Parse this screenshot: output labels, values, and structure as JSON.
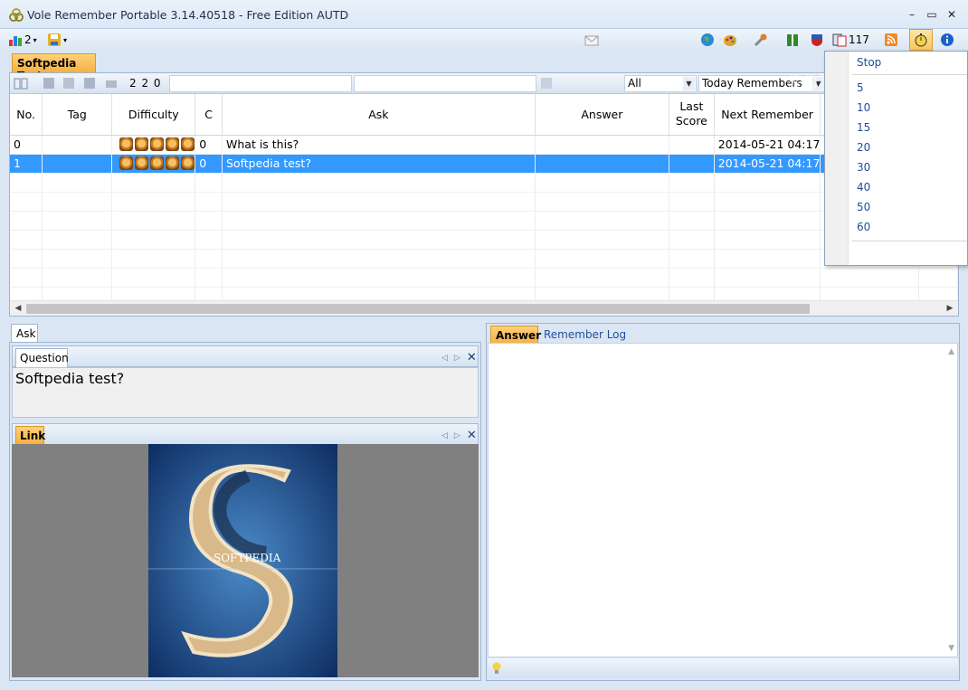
{
  "window": {
    "title": "Vole Remember Portable  3.14.40518 - Free Edition AUTD",
    "minimize": "–",
    "maximize": "▭",
    "close": "✕"
  },
  "toolbar": {
    "stats_count": "2",
    "notify_count": "117"
  },
  "document_tab": "Softpedia Test",
  "filterbar": {
    "counts": "2 2 0",
    "filter_value": "All",
    "mode_value": "Today Remembers"
  },
  "grid": {
    "columns": [
      "No.",
      "Tag",
      "Difficulty",
      "C",
      "Ask",
      "Answer",
      "Last Score",
      "Next Remember"
    ],
    "rows": [
      {
        "no": "0",
        "tag": "",
        "difficulty": 5,
        "c": "0",
        "ask": "What is this?",
        "answer": "",
        "last_score": "",
        "next": "2014-05-21 04:17"
      },
      {
        "no": "1",
        "tag": "",
        "difficulty": 5,
        "c": "0",
        "ask": "Softpedia test?",
        "answer": "",
        "last_score": "",
        "next": "2014-05-21 04:17"
      }
    ]
  },
  "timer_menu": {
    "items": [
      "Stop",
      "5",
      "10",
      "15",
      "20",
      "30",
      "40",
      "50",
      "60"
    ]
  },
  "ask_pane": {
    "tab": "Ask",
    "question_tab": "Question",
    "question_text": "Softpedia test?",
    "link_tab": "Link"
  },
  "answer_pane": {
    "answer_tab": "Answer",
    "log_tab": "Remember Log"
  },
  "watermark": "SOFTPEDIA",
  "image_text": "SOFTPEDIA"
}
